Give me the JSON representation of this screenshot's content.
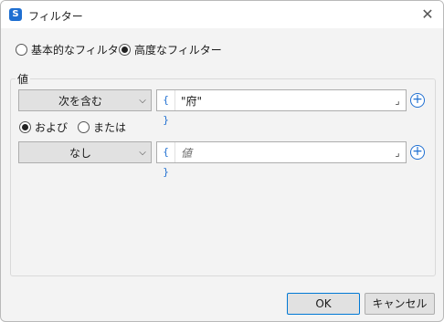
{
  "window": {
    "title": "フィルター",
    "app_icon_letter": "S"
  },
  "mode": {
    "basic_label": "基本的なフィルター",
    "advanced_label": "高度なフィルター",
    "selected": "advanced"
  },
  "group": {
    "label": "値"
  },
  "conditions": [
    {
      "operator": "次を含む",
      "value": "\"府\"",
      "value_is_placeholder": false
    },
    {
      "operator": "なし",
      "value": "値",
      "value_is_placeholder": true
    }
  ],
  "logic": {
    "and_label": "および",
    "or_label": "または",
    "selected": "and"
  },
  "icons": {
    "brace": "{ }",
    "expand": "⌟",
    "add": "+"
  },
  "buttons": {
    "ok": "OK",
    "cancel": "キャンセル"
  }
}
